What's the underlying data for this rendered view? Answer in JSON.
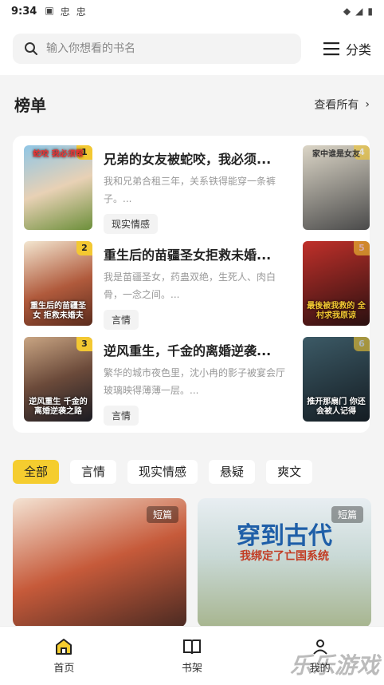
{
  "status": {
    "time": "9:34"
  },
  "search": {
    "placeholder": "输入你想看的书名"
  },
  "category": {
    "label": "分类"
  },
  "ranking": {
    "title": "榜单",
    "see_all": "查看所有",
    "items": [
      {
        "rank": "1",
        "title": "兄弟的女友被蛇咬，我必须...",
        "desc": "我和兄弟合租三年，关系铁得能穿一条裤子。...",
        "tag": "现实情感",
        "cover_text": "蛇咬 我必须帮"
      },
      {
        "rank": "2",
        "title": "重生后的苗疆圣女拒救未婚...",
        "desc": "我是苗疆圣女，药蛊双绝，生死人、肉白骨，一念之间。...",
        "tag": "言情",
        "cover_text": "重生后的苗疆圣女 拒救未婚夫"
      },
      {
        "rank": "3",
        "title": "逆风重生，千金的离婚逆袭...",
        "desc": "繁华的城市夜色里，沈小冉的影子被宴会厅玻璃映得薄薄一层。...",
        "tag": "言情",
        "cover_text": "逆风重生 千金的离婚逆袭之路"
      }
    ],
    "side": [
      {
        "rank": "4",
        "cover_text": "家中谁是女友"
      },
      {
        "rank": "5",
        "cover_text": "最後被我救的 全村求我原谅"
      },
      {
        "rank": "6",
        "cover_text": "推开那扇门 你还会被人记得"
      }
    ]
  },
  "filters": [
    "全部",
    "言情",
    "现实情感",
    "悬疑",
    "爽文"
  ],
  "grid": [
    {
      "label": "短篇",
      "title": "",
      "subtitle": ""
    },
    {
      "label": "短篇",
      "title": "穿到古代",
      "subtitle": "我绑定了亡国系统"
    }
  ],
  "nav": [
    {
      "label": "首页"
    },
    {
      "label": "书架"
    },
    {
      "label": "我的"
    }
  ],
  "watermark": "乐乐游戏",
  "colors": {
    "accent": "#f5cd2f"
  }
}
